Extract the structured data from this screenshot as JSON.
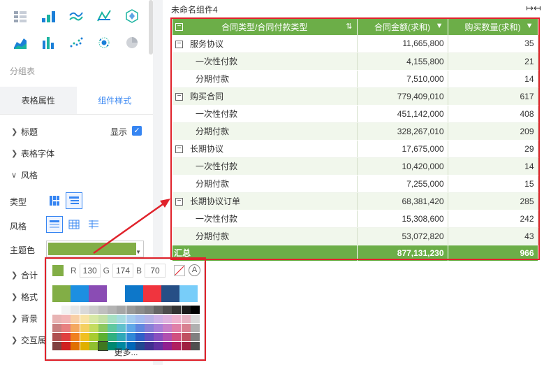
{
  "left": {
    "group_title": "分组表",
    "tabs": [
      {
        "label": "表格属性",
        "active": false
      },
      {
        "label": "组件样式",
        "active": true
      }
    ],
    "sections": {
      "title": "标题",
      "show": "显示",
      "table_font": "表格字体",
      "style": "风格",
      "type": "类型",
      "style_label": "风格",
      "theme_color": "主题色",
      "total": "合计",
      "format": "格式",
      "background": "背景",
      "interaction": "交互属"
    }
  },
  "color_picker": {
    "current_color": "#82ae46",
    "r_label": "R",
    "r": "130",
    "g_label": "G",
    "g": "174",
    "b_label": "B",
    "b": "70",
    "more": "更多..."
  },
  "widget": {
    "title": "未命名组件4",
    "headers": [
      "合同类型/合同付款类型",
      "合同金额(求和)",
      "购买数量(求和)"
    ],
    "rows": [
      {
        "name": "服务协议",
        "amount": "11,665,800",
        "qty": "35",
        "level": 0
      },
      {
        "name": "一次性付款",
        "amount": "4,155,800",
        "qty": "21",
        "level": 1
      },
      {
        "name": "分期付款",
        "amount": "7,510,000",
        "qty": "14",
        "level": 1
      },
      {
        "name": "购买合同",
        "amount": "779,409,010",
        "qty": "617",
        "level": 0
      },
      {
        "name": "一次性付款",
        "amount": "451,142,000",
        "qty": "408",
        "level": 1
      },
      {
        "name": "分期付款",
        "amount": "328,267,010",
        "qty": "209",
        "level": 1
      },
      {
        "name": "长期协议",
        "amount": "17,675,000",
        "qty": "29",
        "level": 0
      },
      {
        "name": "一次性付款",
        "amount": "10,420,000",
        "qty": "14",
        "level": 1
      },
      {
        "name": "分期付款",
        "amount": "7,255,000",
        "qty": "15",
        "level": 1
      },
      {
        "name": "长期协议订单",
        "amount": "68,381,420",
        "qty": "285",
        "level": 0
      },
      {
        "name": "一次性付款",
        "amount": "15,308,600",
        "qty": "242",
        "level": 1
      },
      {
        "name": "分期付款",
        "amount": "53,072,820",
        "qty": "43",
        "level": 1
      }
    ],
    "total": {
      "label": "汇总",
      "amount": "877,131,230",
      "qty": "966"
    }
  },
  "colors": {
    "theme_green": "#6cae48",
    "accent_blue": "#3685f2",
    "highlight_red": "#e0222b"
  },
  "icons": [
    "table-icon",
    "bar-icon",
    "line-icon",
    "radar-icon",
    "hexagon-icon",
    "area-icon",
    "stacked-bar-icon",
    "scatter-icon",
    "dot-cluster-icon",
    "pie-icon",
    "sort-icon",
    "dropdown-icon",
    "expand-width-icon",
    "collapse-icon",
    "check-icon",
    "no-color-icon",
    "auto-color-icon"
  ]
}
